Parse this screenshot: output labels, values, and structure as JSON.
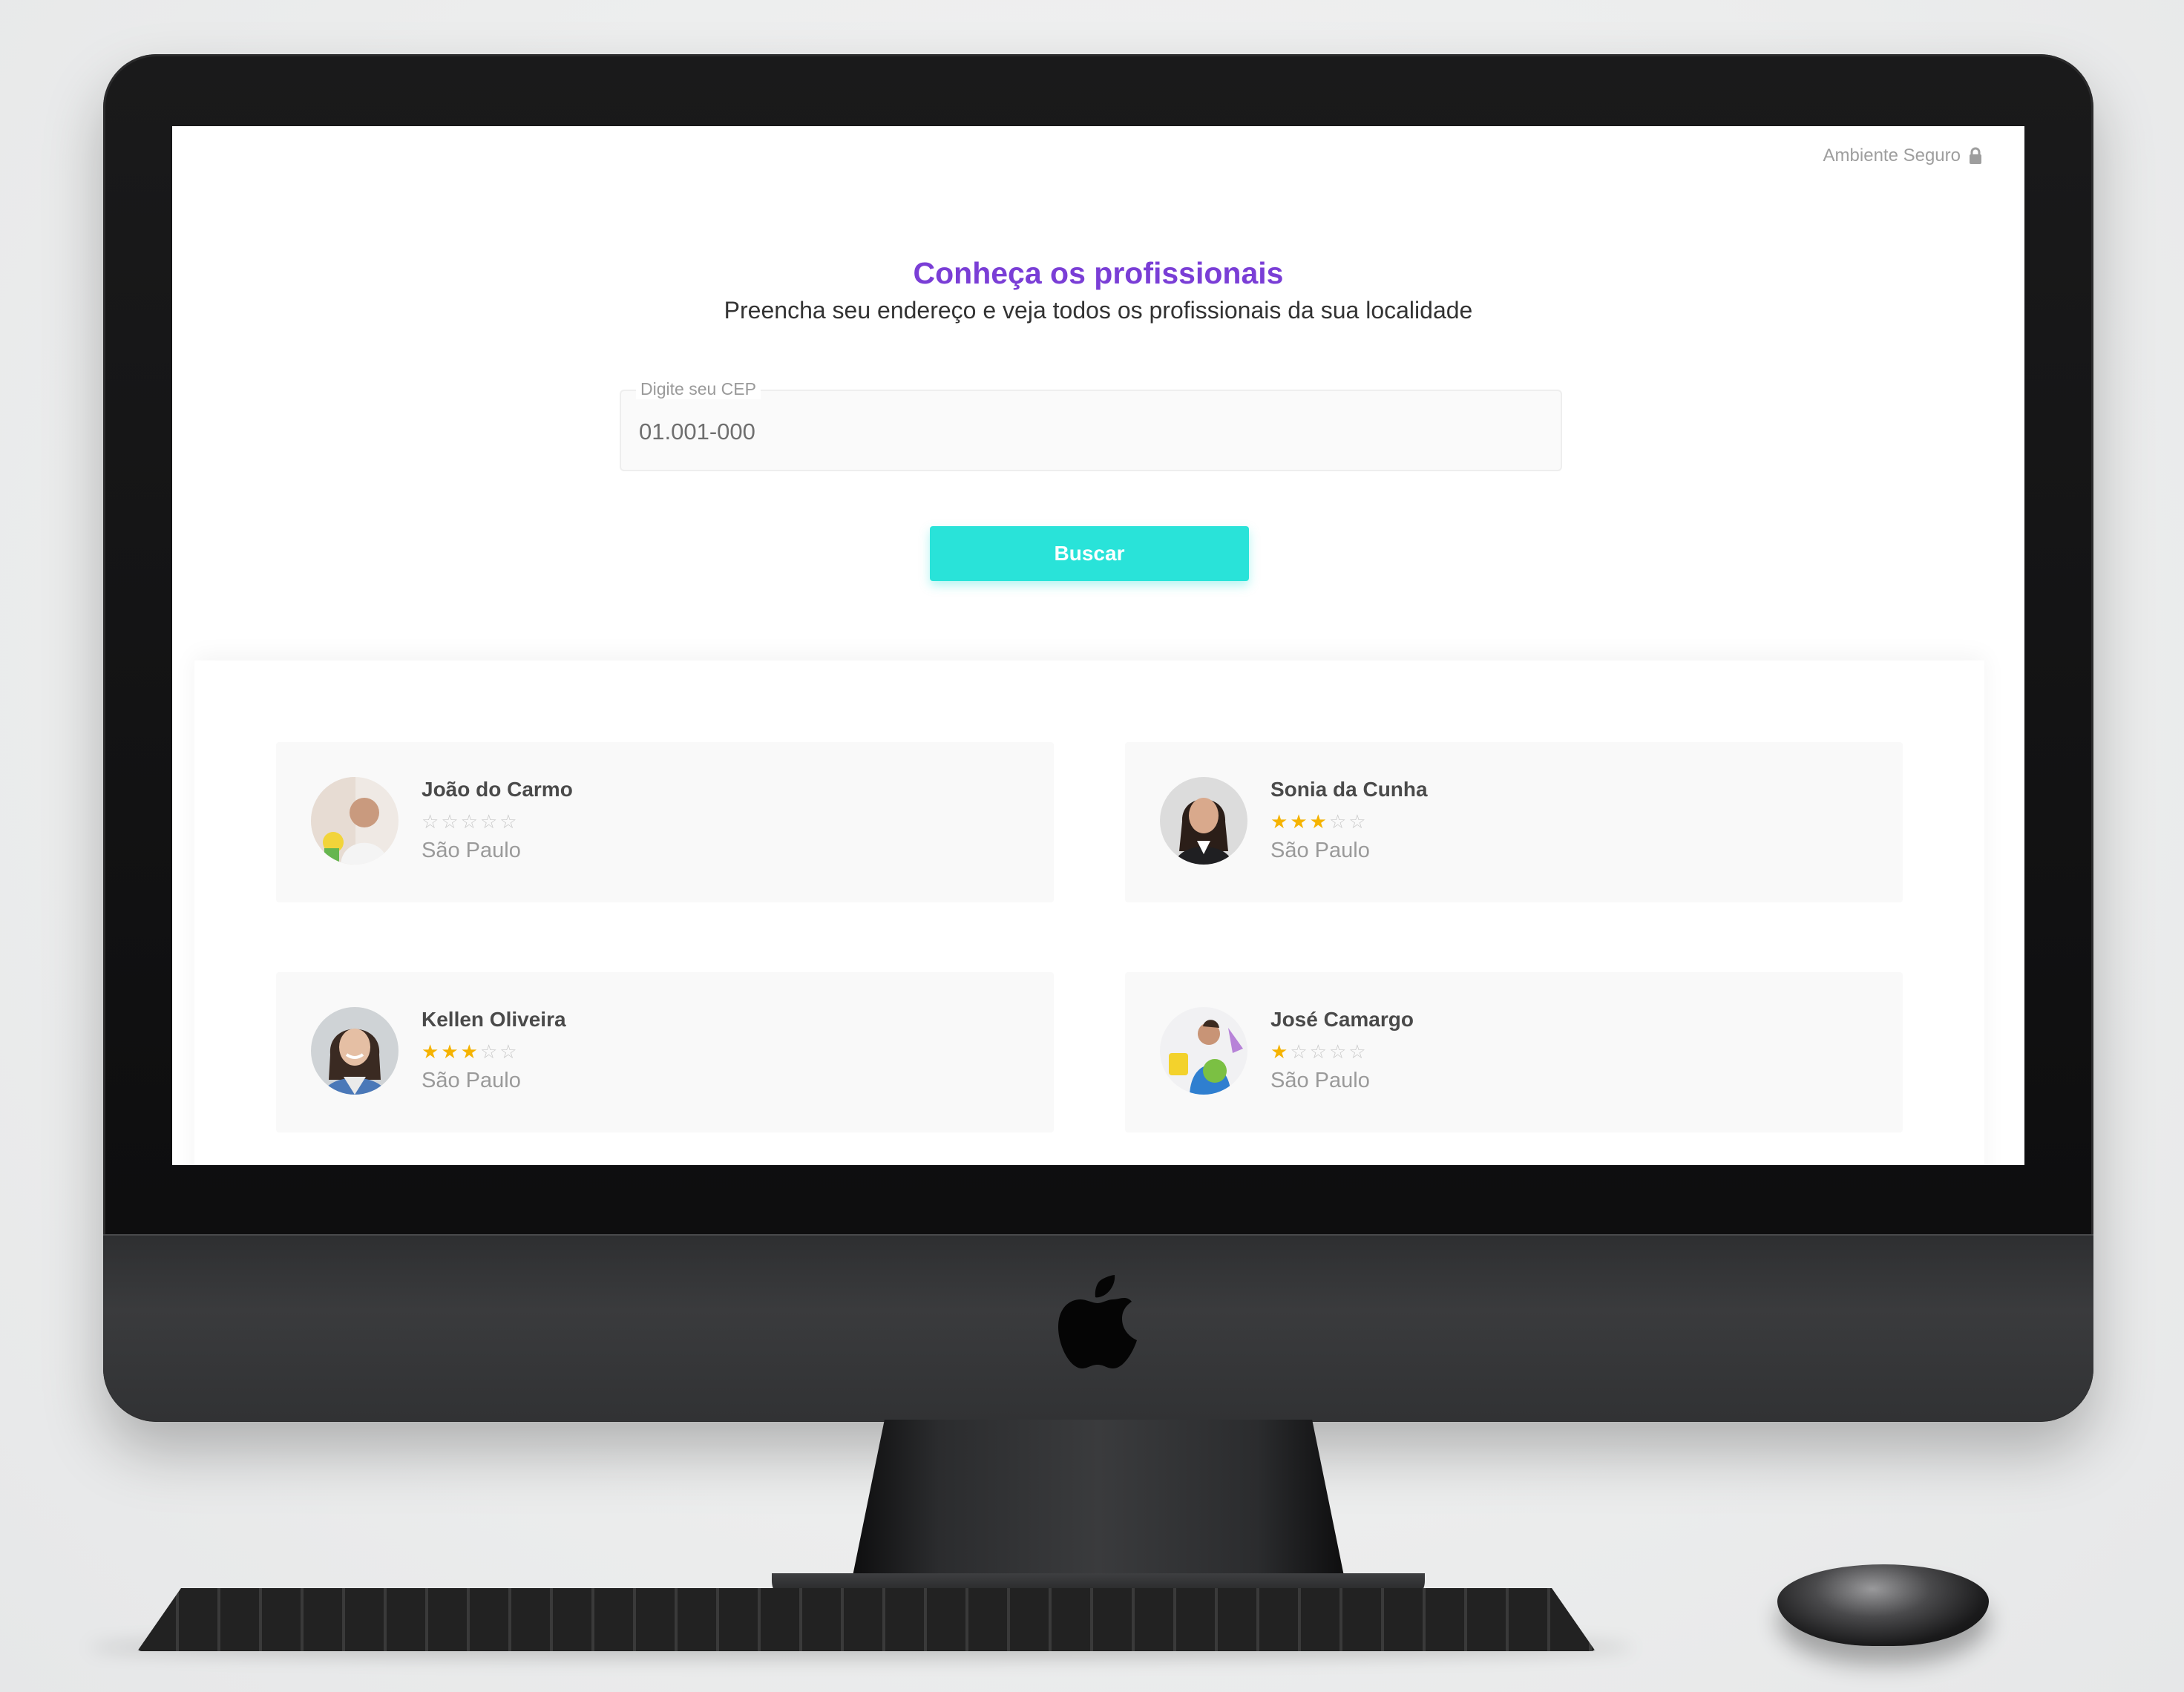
{
  "header": {
    "secure_label": "Ambiente Seguro",
    "lock_icon": "lock-icon"
  },
  "hero": {
    "title": "Conheça os profissionais",
    "subtitle": "Preencha seu endereço e veja todos os profissionais da sua localidade"
  },
  "cep": {
    "label": "Digite seu CEP",
    "value": "01.001-000"
  },
  "search": {
    "button_label": "Buscar"
  },
  "colors": {
    "accent_purple": "#7a3ed6",
    "button_teal": "#29e3d9",
    "star_gold": "#f5b301"
  },
  "professionals": [
    {
      "name": "João do Carmo",
      "rating": 0,
      "max_rating": 5,
      "city": "São Paulo"
    },
    {
      "name": "Sonia da Cunha",
      "rating": 3,
      "max_rating": 5,
      "city": "São Paulo"
    },
    {
      "name": "Kellen Oliveira",
      "rating": 3,
      "max_rating": 5,
      "city": "São Paulo"
    },
    {
      "name": "José Camargo",
      "rating": 1,
      "max_rating": 5,
      "city": "São Paulo"
    }
  ]
}
